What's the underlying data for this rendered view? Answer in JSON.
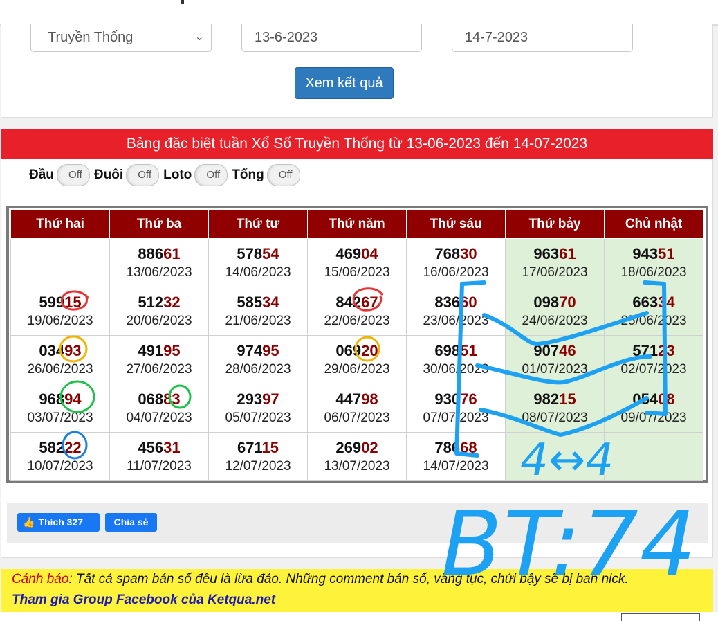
{
  "form": {
    "type_select": "Truyền Thống",
    "date_from": "13-6-2023",
    "date_to": "14-7-2023",
    "submit_label": "Xem kết quả"
  },
  "table_title": "Bảng đặc biệt tuần Xổ Số Truyền Thống từ 13-06-2023 đến 14-07-2023",
  "toggles": [
    {
      "label": "Đầu",
      "state": "Off"
    },
    {
      "label": "Đuôi",
      "state": "Off"
    },
    {
      "label": "Loto",
      "state": "Off"
    },
    {
      "label": "Tổng",
      "state": "Off"
    }
  ],
  "headers": [
    "Thứ hai",
    "Thứ ba",
    "Thứ tư",
    "Thứ năm",
    "Thứ sáu",
    "Thứ bảy",
    "Chủ nhật"
  ],
  "weeks": [
    [
      {
        "head": "",
        "tail": "",
        "date": ""
      },
      {
        "head": "886",
        "tail": "61",
        "date": "13/06/2023"
      },
      {
        "head": "578",
        "tail": "54",
        "date": "14/06/2023"
      },
      {
        "head": "469",
        "tail": "04",
        "date": "15/06/2023"
      },
      {
        "head": "768",
        "tail": "30",
        "date": "16/06/2023"
      },
      {
        "head": "963",
        "tail": "61",
        "date": "17/06/2023"
      },
      {
        "head": "943",
        "tail": "51",
        "date": "18/06/2023"
      }
    ],
    [
      {
        "head": "599",
        "tail": "15",
        "date": "19/06/2023"
      },
      {
        "head": "512",
        "tail": "32",
        "date": "20/06/2023"
      },
      {
        "head": "585",
        "tail": "34",
        "date": "21/06/2023"
      },
      {
        "head": "842",
        "tail": "67",
        "date": "22/06/2023"
      },
      {
        "head": "836",
        "tail": "60",
        "date": "23/06/2023"
      },
      {
        "head": "098",
        "tail": "70",
        "date": "24/06/2023"
      },
      {
        "head": "663",
        "tail": "34",
        "date": "25/06/2023"
      }
    ],
    [
      {
        "head": "034",
        "tail": "93",
        "date": "26/06/2023"
      },
      {
        "head": "491",
        "tail": "95",
        "date": "27/06/2023"
      },
      {
        "head": "974",
        "tail": "95",
        "date": "28/06/2023"
      },
      {
        "head": "069",
        "tail": "20",
        "date": "29/06/2023"
      },
      {
        "head": "698",
        "tail": "51",
        "date": "30/06/2023"
      },
      {
        "head": "907",
        "tail": "46",
        "date": "01/07/2023"
      },
      {
        "head": "571",
        "tail": "23",
        "date": "02/07/2023"
      }
    ],
    [
      {
        "head": "968",
        "tail": "94",
        "date": "03/07/2023"
      },
      {
        "head": "068",
        "tail": "83",
        "date": "04/07/2023"
      },
      {
        "head": "293",
        "tail": "97",
        "date": "05/07/2023"
      },
      {
        "head": "447",
        "tail": "98",
        "date": "06/07/2023"
      },
      {
        "head": "930",
        "tail": "76",
        "date": "07/07/2023"
      },
      {
        "head": "982",
        "tail": "15",
        "date": "08/07/2023"
      },
      {
        "head": "054",
        "tail": "08",
        "date": "09/07/2023"
      }
    ],
    [
      {
        "head": "582",
        "tail": "22",
        "date": "10/07/2023"
      },
      {
        "head": "456",
        "tail": "31",
        "date": "11/07/2023"
      },
      {
        "head": "671",
        "tail": "15",
        "date": "12/07/2023"
      },
      {
        "head": "269",
        "tail": "02",
        "date": "13/07/2023"
      },
      {
        "head": "786",
        "tail": "68",
        "date": "14/07/2023"
      },
      {
        "head": "",
        "tail": "",
        "date": ""
      },
      {
        "head": "",
        "tail": "",
        "date": ""
      }
    ]
  ],
  "social": {
    "like_label": "Thích 327",
    "share_label": "Chia sẻ"
  },
  "warning": {
    "label": "Cảnh báo",
    "text": ": Tất cả spam bán số đều là lừa đảo. Những comment bán số, văng tục, chửi bậy sẽ bị ban nick.",
    "group_link": "Tham gia Group Facebook của Ketqua.net"
  },
  "annotations": {
    "arrow_note": "4↔4",
    "big_note": "BT:74"
  },
  "colors": {
    "header_red": "#e8202a",
    "table_head": "#900000",
    "weekend_green": "#dff0d8",
    "button_blue": "#2f79bd",
    "warning_yellow": "#fff23a",
    "ink_blue": "#1da1f2"
  }
}
